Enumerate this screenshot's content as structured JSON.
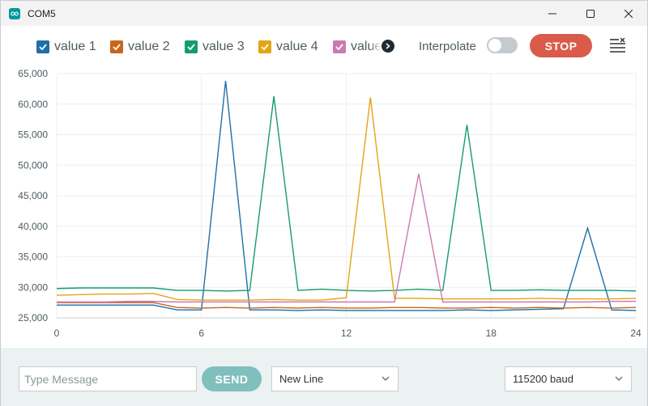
{
  "window": {
    "title": "COM5"
  },
  "toolbar": {
    "legend": [
      {
        "label": "value 1",
        "color": "#1f6fa8"
      },
      {
        "label": "value 2",
        "color": "#c8651b"
      },
      {
        "label": "value 3",
        "color": "#159b74"
      },
      {
        "label": "value 4",
        "color": "#e4a414"
      },
      {
        "label": "value",
        "color": "#cb7bb0"
      }
    ],
    "interpolate_label": "Interpolate",
    "interpolate_on": false,
    "stop_label": "STOP"
  },
  "chart_data": {
    "type": "line",
    "x": [
      0,
      1,
      2,
      3,
      4,
      5,
      6,
      7,
      8,
      9,
      10,
      11,
      12,
      13,
      14,
      15,
      16,
      17,
      18,
      19,
      20,
      21,
      22,
      23,
      24
    ],
    "xlim": [
      0,
      24
    ],
    "ylim": [
      25000,
      65000
    ],
    "x_ticks": [
      "0",
      "6",
      "12",
      "18",
      "24"
    ],
    "y_ticks": [
      "25,000",
      "30,000",
      "35,000",
      "40,000",
      "45,000",
      "50,000",
      "55,000",
      "60,000",
      "65,000"
    ],
    "grid": true,
    "series": [
      {
        "name": "value 1",
        "color": "#1f6fa8",
        "values": [
          27100,
          27100,
          27100,
          27100,
          27100,
          26300,
          26300,
          63800,
          26300,
          26300,
          26200,
          26300,
          26200,
          26200,
          26200,
          26200,
          26200,
          26300,
          26200,
          26300,
          26400,
          26500,
          39700,
          26300,
          26200
        ]
      },
      {
        "name": "value 2",
        "color": "#c8651b",
        "values": [
          27500,
          27500,
          27500,
          27500,
          27500,
          26700,
          26600,
          26700,
          26600,
          26700,
          26600,
          26700,
          26600,
          26600,
          26700,
          26700,
          26600,
          26600,
          26700,
          26600,
          26700,
          26600,
          26700,
          26600,
          26700
        ]
      },
      {
        "name": "value 3",
        "color": "#159b74",
        "values": [
          29800,
          29900,
          29900,
          29900,
          29900,
          29500,
          29500,
          29400,
          29500,
          61300,
          29500,
          29700,
          29500,
          29400,
          29500,
          29700,
          29500,
          56600,
          29500,
          29500,
          29600,
          29500,
          29500,
          29500,
          29400
        ]
      },
      {
        "name": "value 4",
        "color": "#e4a414",
        "values": [
          28700,
          28800,
          28900,
          28900,
          29000,
          28000,
          27900,
          27900,
          27900,
          28000,
          27900,
          27900,
          28300,
          61100,
          28200,
          28200,
          28100,
          28100,
          28100,
          28100,
          28200,
          28100,
          28100,
          28100,
          28200
        ]
      },
      {
        "name": "value",
        "color": "#cb7bb0",
        "values": [
          27600,
          27600,
          27600,
          27700,
          27700,
          27600,
          27600,
          27600,
          27600,
          27600,
          27600,
          27600,
          27600,
          27600,
          27600,
          48600,
          27600,
          27600,
          27600,
          27600,
          27600,
          27600,
          27600,
          27700,
          27700
        ]
      }
    ]
  },
  "footer": {
    "message_placeholder": "Type Message",
    "send_label": "SEND",
    "line_ending": "New Line",
    "baud": "115200 baud"
  }
}
